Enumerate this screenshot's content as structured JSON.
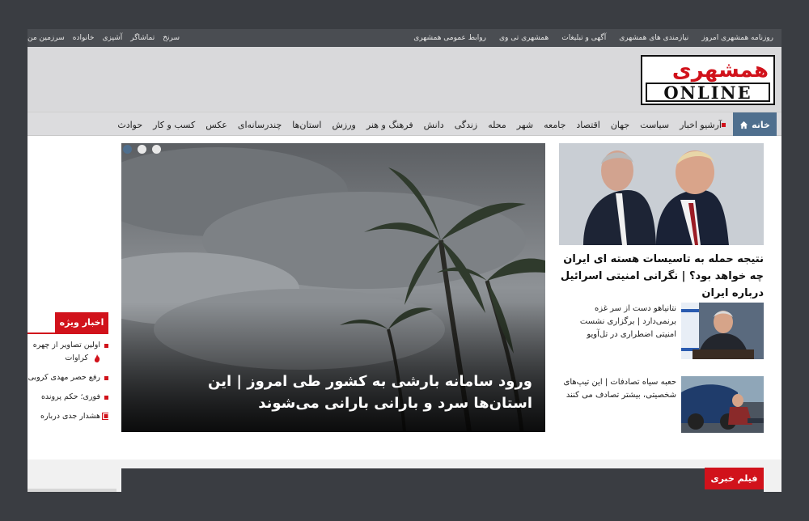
{
  "topbar": {
    "right_links": [
      "روزنامه همشهری امروز",
      "نیازمندی های همشهری",
      "آگهی و تبلیغات",
      "همشهری تی وی",
      "روابط عمومی همشهری"
    ],
    "left_links": [
      "سرنخ",
      "تماشاگر",
      "آشپزی",
      "خانواده",
      "سرزمین من"
    ]
  },
  "logo": {
    "fa": "همشهری",
    "en": "ONLINE"
  },
  "nav": {
    "home": "خانه",
    "items": [
      "آرشیو اخبار",
      "سیاست",
      "جهان",
      "اقتصاد",
      "جامعه",
      "شهر",
      "محله",
      "زندگی",
      "دانش",
      "فرهنگ و هنر",
      "ورزش",
      "استان‌ها",
      "چندرسانه‌ای",
      "عکس",
      "کسب و کار",
      "حوادث"
    ]
  },
  "featured": {
    "title": "نتیجه حمله به تاسیسات هسته ای ایران چه خواهد بود؟ | نگرانی امنیتی اسرائیل درباره ایران"
  },
  "side_items": [
    {
      "text": "نتانیاهو دست از سر غزه برنمی‌دارد | برگزاری نشست امنیتی اضطراری در تل‌آویو"
    },
    {
      "text": "حعبه سیاه تصادفات | این تیپ‌های شخصیتی، بیشتر تصادف می کنند"
    }
  ],
  "slider": {
    "caption": "ورود سامانه بارشی به کشور طی امروز | این استان‌ها سرد و بارانی بارانی می‌شوند"
  },
  "special": {
    "title": "اخبار ویژه",
    "items": [
      "اولین تصاویر از چهره",
      "کراوات",
      "رفع حصر مهدی کروبی",
      "فوری؛ حکم پرونده",
      "هشدار جدی درباره"
    ]
  },
  "video": {
    "label": "فیلم خبری"
  },
  "colors": {
    "accent_red": "#d1121b",
    "nav_blue": "#4f6f8e",
    "dark": "#3a3d42"
  }
}
